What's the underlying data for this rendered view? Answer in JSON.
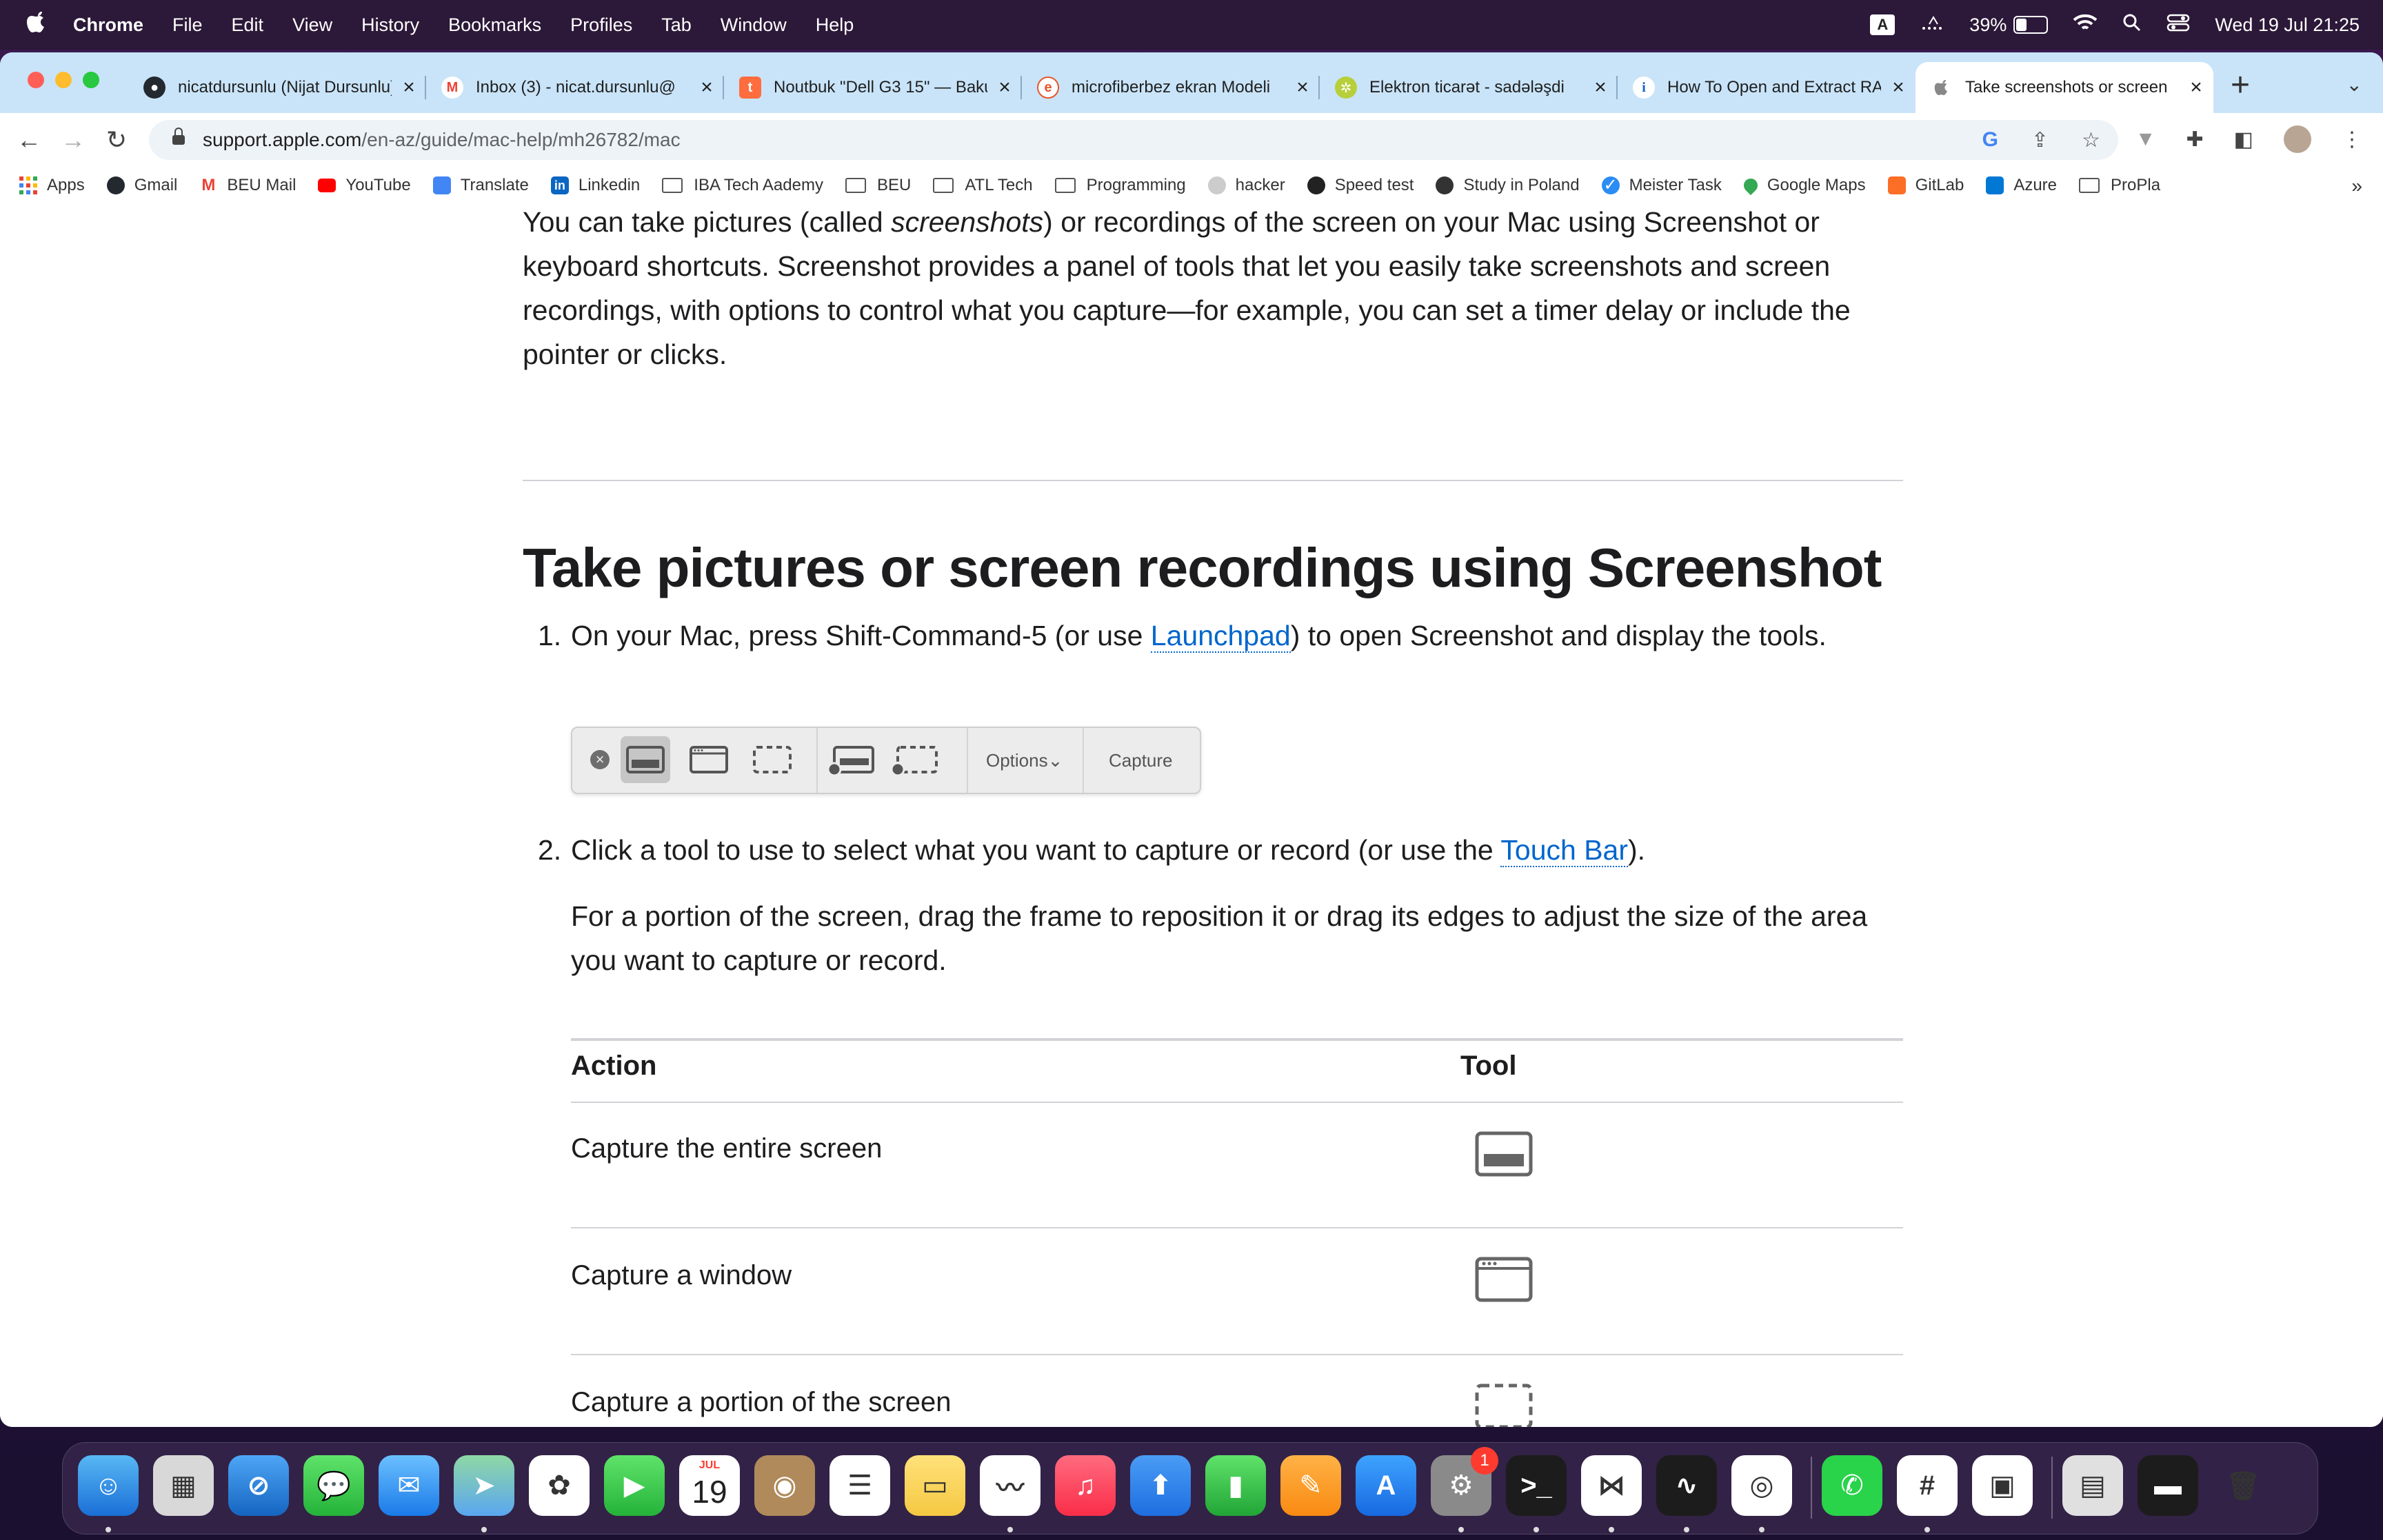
{
  "menubar": {
    "app": "Chrome",
    "items": [
      "File",
      "Edit",
      "View",
      "History",
      "Bookmarks",
      "Profiles",
      "Tab",
      "Window",
      "Help"
    ],
    "input_source": "A",
    "battery": "39%",
    "battery_level": 0.39,
    "clock": "Wed 19 Jul  21:25"
  },
  "tabs": [
    {
      "title": "nicatdursunlu (Nijat Dursunlu)",
      "icon": "github-icon"
    },
    {
      "title": "Inbox (3) - nicat.dursunlu@",
      "icon": "gmail-icon"
    },
    {
      "title": "Noutbuk \"Dell G3 15\" — Baku",
      "icon": "tap-az-icon"
    },
    {
      "title": "microfiberbez ekran Modeli",
      "icon": "site-icon"
    },
    {
      "title": "Elektron ticarət - sadələşdi",
      "icon": "gear-site-icon"
    },
    {
      "title": "How To Open and Extract RAR",
      "icon": "info-icon"
    },
    {
      "title": "Take screenshots or screen",
      "icon": "apple-icon"
    }
  ],
  "address_bar": {
    "host": "support.apple.com",
    "path": "/en-az/guide/mac-help/mh26782/mac"
  },
  "bookmarks": {
    "items": [
      {
        "label": "Apps",
        "kind": "apps"
      },
      {
        "label": "Gmail",
        "kind": "github"
      },
      {
        "label": "BEU Mail",
        "kind": "gmail"
      },
      {
        "label": "YouTube",
        "kind": "youtube"
      },
      {
        "label": "Translate",
        "kind": "translate"
      },
      {
        "label": "Linkedin",
        "kind": "linkedin"
      },
      {
        "label": "IBA Tech Aademy",
        "kind": "folder"
      },
      {
        "label": "BEU",
        "kind": "folder"
      },
      {
        "label": "ATL Tech",
        "kind": "folder"
      },
      {
        "label": "Programming",
        "kind": "folder"
      },
      {
        "label": "hacker",
        "kind": "github"
      },
      {
        "label": "Speed test",
        "kind": "speed"
      },
      {
        "label": "Study in Poland",
        "kind": "globe"
      },
      {
        "label": "Meister Task",
        "kind": "check"
      },
      {
        "label": "Google Maps",
        "kind": "maps"
      },
      {
        "label": "GitLab",
        "kind": "gitlab"
      },
      {
        "label": "Azure",
        "kind": "azure"
      },
      {
        "label": "ProPla",
        "kind": "folder"
      }
    ],
    "more": "»"
  },
  "article": {
    "intro": "You can take pictures (called screenshots) or recordings of the screen on your Mac using Screenshot or keyboard shortcuts. Screenshot provides a panel of tools that let you easily take screenshots and screen recordings, with options to control what you capture—for example, you can set a timer delay or include the pointer or clicks.",
    "intro_parts": {
      "a": "You can take pictures (called ",
      "em": "screenshots",
      "b": ") or recordings of the screen on your Mac using Screenshot or keyboard shortcuts. Screenshot provides a panel of tools that let you easily take screenshots and screen recordings, with options to control what you capture—for example, you can set a timer delay or include the pointer or clicks."
    },
    "heading": "Take pictures or screen recordings using Screenshot",
    "step1": {
      "num": "1.",
      "a": "On your Mac, press Shift-Command-5 (or use ",
      "link": "Launchpad",
      "b": ") to open Screenshot and display the tools."
    },
    "screenshot_toolbar": {
      "close": "×",
      "options": "Options",
      "options_chevron": "⌄",
      "capture": "Capture"
    },
    "step2": {
      "num": "2.",
      "a": "Click a tool to use to select what you want to capture or record (or use the ",
      "link": "Touch Bar",
      "b": ").",
      "detail": "For a portion of the screen, drag the frame to reposition it or drag its edges to adjust the size of the area you want to capture or record."
    },
    "table": {
      "headers": [
        "Action",
        "Tool"
      ],
      "rows": [
        {
          "action": "Capture the entire screen",
          "tool_icon": "entire-screen-icon"
        },
        {
          "action": "Capture a window",
          "tool_icon": "window-icon"
        },
        {
          "action": "Capture a portion of the screen",
          "tool_icon": "portion-icon"
        }
      ]
    }
  },
  "dock": {
    "apps": [
      {
        "name": "Finder"
      },
      {
        "name": "Launchpad"
      },
      {
        "name": "Safari"
      },
      {
        "name": "Messages"
      },
      {
        "name": "Mail"
      },
      {
        "name": "Maps"
      },
      {
        "name": "Photos"
      },
      {
        "name": "FaceTime"
      },
      {
        "name": "Calendar",
        "month": "JUL",
        "day": "19"
      },
      {
        "name": "Contacts"
      },
      {
        "name": "Reminders"
      },
      {
        "name": "Notes"
      },
      {
        "name": "Freeform"
      },
      {
        "name": "Music"
      },
      {
        "name": "Keynote"
      },
      {
        "name": "Numbers"
      },
      {
        "name": "Pages"
      },
      {
        "name": "App Store"
      },
      {
        "name": "System Settings",
        "badge": "1"
      },
      {
        "name": "Terminal"
      },
      {
        "name": "VS Code"
      },
      {
        "name": "Activity Monitor"
      },
      {
        "name": "Chrome"
      },
      {
        "name": "WhatsApp"
      },
      {
        "name": "Slack"
      },
      {
        "name": "Preview"
      },
      {
        "name": "Files"
      },
      {
        "name": "Terminal Window"
      },
      {
        "name": "Trash"
      }
    ]
  }
}
